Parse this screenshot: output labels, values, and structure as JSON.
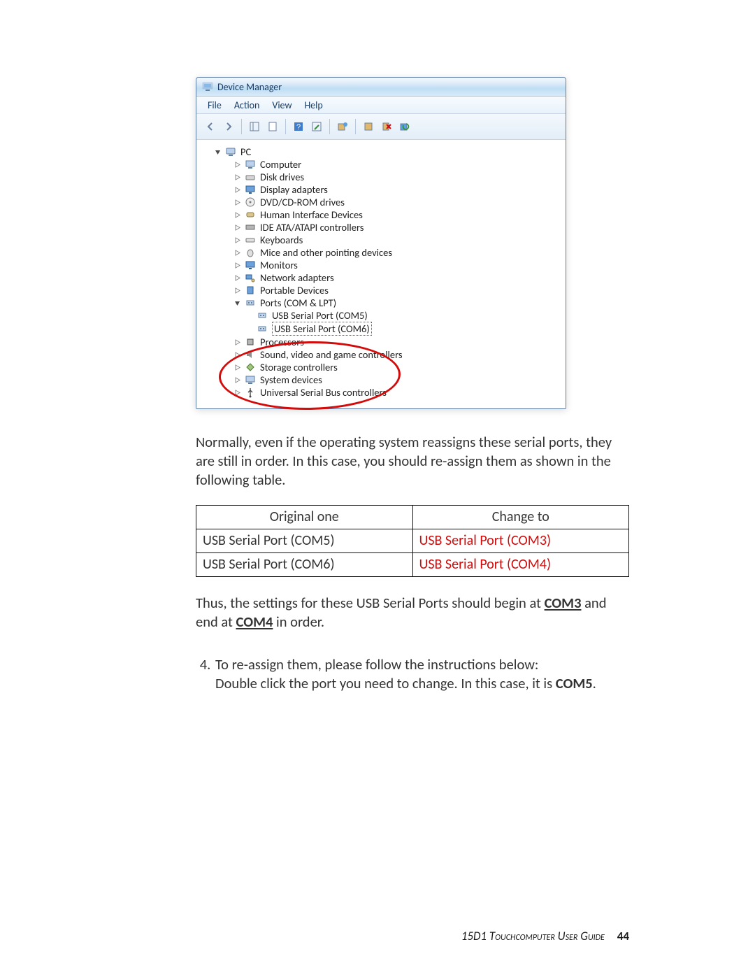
{
  "dm": {
    "title": "Device Manager",
    "menu": {
      "file": "File",
      "action": "Action",
      "view": "View",
      "help": "Help"
    },
    "tree": {
      "root": "PC",
      "items": [
        "Computer",
        "Disk drives",
        "Display adapters",
        "DVD/CD-ROM drives",
        "Human Interface Devices",
        "IDE ATA/ATAPI controllers",
        "Keyboards",
        "Mice and other pointing devices",
        "Monitors",
        "Network adapters",
        "Portable Devices"
      ],
      "ports": {
        "label": "Ports (COM & LPT)",
        "children": [
          "USB Serial Port (COM5)",
          "USB Serial Port (COM6)"
        ]
      },
      "rest": [
        "Processors",
        "Sound, video and game controllers",
        "Storage controllers",
        "System devices",
        "Universal Serial Bus controllers"
      ]
    }
  },
  "para1": "Normally, even if the operating system reassigns these serial ports, they are still in order. In this case, you should re-assign them as shown in the following table.",
  "table": {
    "head": {
      "c1": "Original one",
      "c2": "Change to"
    },
    "rows": [
      {
        "c1": "USB Serial Port (COM5)",
        "c2": "USB Serial Port (COM3)"
      },
      {
        "c1": "USB Serial Port (COM6)",
        "c2": "USB Serial Port (COM4)"
      }
    ]
  },
  "para2_a": "Thus, the settings for these USB Serial Ports should begin at ",
  "para2_b": "COM3",
  "para2_c": " and end at ",
  "para2_d": "COM4",
  "para2_e": " in order.",
  "step4": {
    "line1": "To re-assign them, please follow the instructions below:",
    "line2_a": "Double click the port you need to change. In this case, it is ",
    "line2_b": "COM5",
    "line2_c": "."
  },
  "footer": {
    "guide": "15D1 Touchcomputer User Guide",
    "page": "44"
  }
}
